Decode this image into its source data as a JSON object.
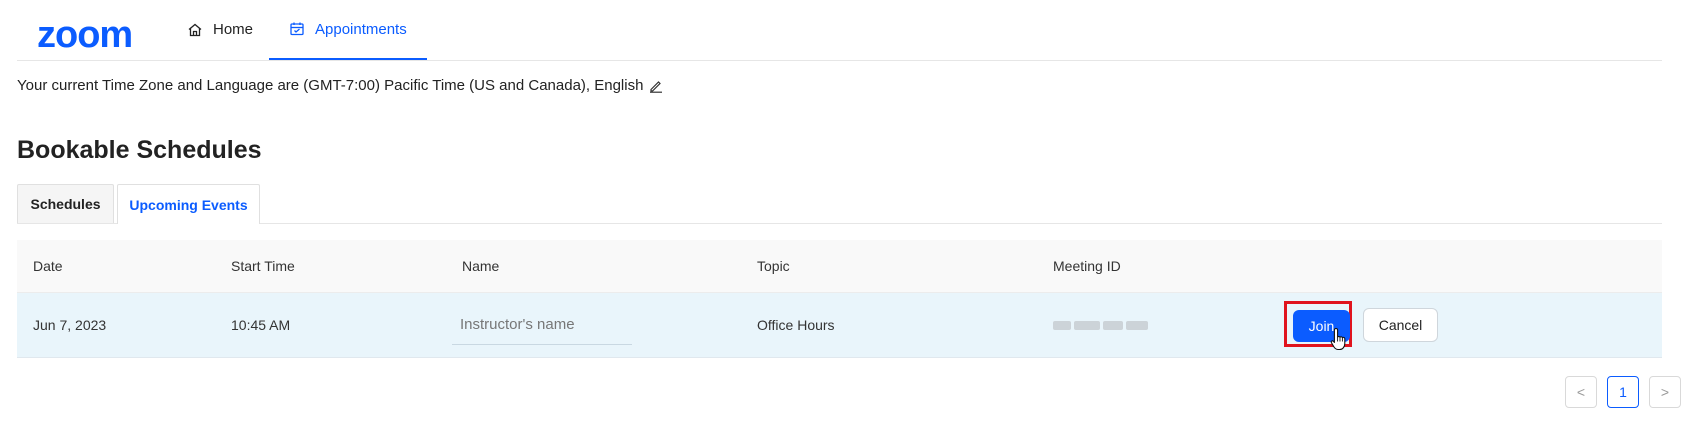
{
  "app": {
    "logo_text": "zoom",
    "brand_color": "#0b5cff"
  },
  "nav": {
    "items": [
      {
        "label": "Home",
        "icon": "home-icon"
      },
      {
        "label": "Appointments",
        "icon": "calendar-icon",
        "active": true
      }
    ]
  },
  "timezone": {
    "text": "Your current Time Zone and Language are (GMT-7:00) Pacific Time (US and Canada), English",
    "edit_icon": "pencil-icon"
  },
  "page": {
    "title": "Bookable Schedules"
  },
  "tabs": [
    {
      "label": "Schedules",
      "active": false
    },
    {
      "label": "Upcoming Events",
      "active": true
    }
  ],
  "table": {
    "columns": [
      "Date",
      "Start Time",
      "Name",
      "Topic",
      "Meeting ID"
    ],
    "rows": [
      {
        "date": "Jun 7, 2023",
        "start_time": "10:45 AM",
        "name_placeholder": "Instructor's name",
        "topic": "Office Hours",
        "join_label": "Join",
        "cancel_label": "Cancel"
      }
    ]
  },
  "pagination": {
    "prev": "<",
    "current": "1",
    "next": ">"
  },
  "colors": {
    "accent": "#0b5cff",
    "highlight_box": "#e0141e",
    "row_background": "#e9f5fb"
  }
}
